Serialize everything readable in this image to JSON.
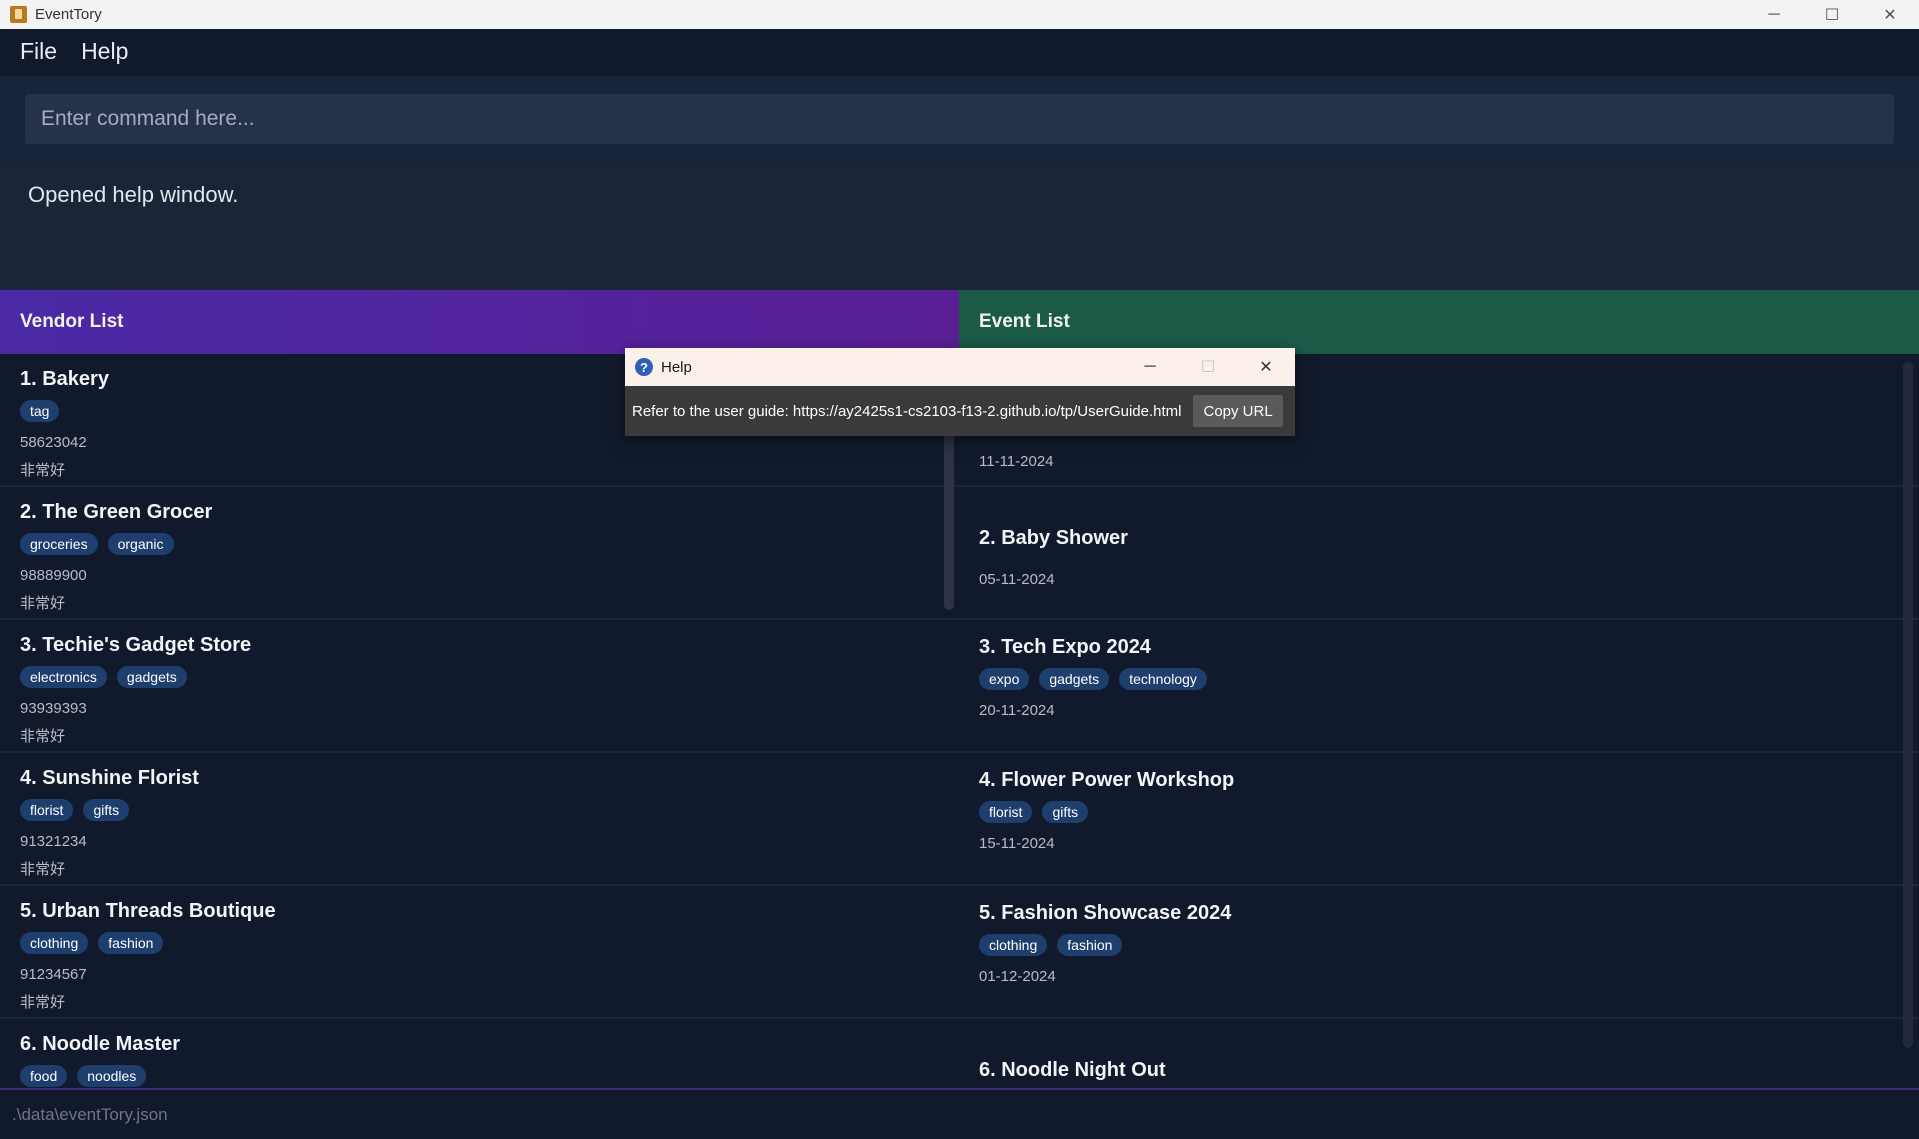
{
  "window": {
    "title": "EventTory",
    "minimize": "─",
    "maximize": "☐",
    "close": "✕"
  },
  "menu": {
    "file": "File",
    "help": "Help"
  },
  "command": {
    "placeholder": "Enter command here..."
  },
  "result": {
    "text": "Opened help window."
  },
  "vendors": {
    "header": "Vendor List",
    "items": [
      {
        "title": "1. Bakery",
        "tags": [
          "tag"
        ],
        "phone": "58623042",
        "desc": "非常好"
      },
      {
        "title": "2. The Green Grocer",
        "tags": [
          "groceries",
          "organic"
        ],
        "phone": "98889900",
        "desc": "非常好"
      },
      {
        "title": "3. Techie's Gadget Store",
        "tags": [
          "electronics",
          "gadgets"
        ],
        "phone": "93939393",
        "desc": "非常好"
      },
      {
        "title": "4. Sunshine Florist",
        "tags": [
          "florist",
          "gifts"
        ],
        "phone": "91321234",
        "desc": "非常好"
      },
      {
        "title": "5. Urban Threads Boutique",
        "tags": [
          "clothing",
          "fashion"
        ],
        "phone": "91234567",
        "desc": "非常好"
      },
      {
        "title": "6. Noodle Master",
        "tags": [
          "food",
          "noodles"
        ],
        "phone": "",
        "desc": ""
      }
    ]
  },
  "events": {
    "header": "Event List",
    "items": [
      {
        "title": "",
        "tags": [],
        "date": "11-11-2024"
      },
      {
        "title": "2. Baby Shower",
        "tags": [],
        "date": "05-11-2024"
      },
      {
        "title": "3. Tech Expo 2024",
        "tags": [
          "expo",
          "gadgets",
          "technology"
        ],
        "date": "20-11-2024"
      },
      {
        "title": "4. Flower Power Workshop",
        "tags": [
          "florist",
          "gifts"
        ],
        "date": "15-11-2024"
      },
      {
        "title": "5. Fashion Showcase 2024",
        "tags": [
          "clothing",
          "fashion"
        ],
        "date": "01-12-2024"
      },
      {
        "title": "6. Noodle Night Out",
        "tags": [],
        "date": ""
      }
    ]
  },
  "status": {
    "path": ".\\data\\eventTory.json"
  },
  "help_dialog": {
    "title": "Help",
    "message": "Refer to the user guide: https://ay2425s1-cs2103-f13-2.github.io/tp/UserGuide.html",
    "copy_button": "Copy URL"
  }
}
